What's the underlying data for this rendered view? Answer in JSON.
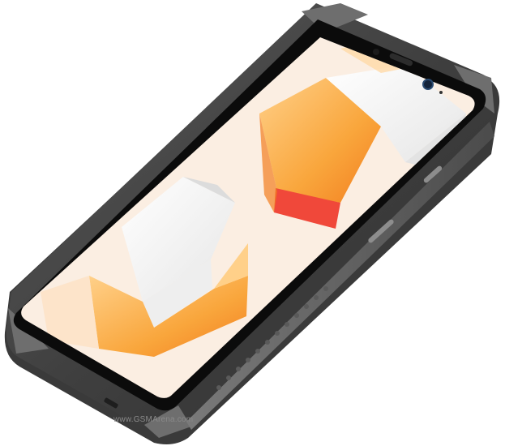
{
  "photo": {
    "subject": "rugged smartphone",
    "watermark": "www.GSMArena.com"
  },
  "colors": {
    "frame_outer": "#4a4a4a",
    "frame_mid": "#6b6b6b",
    "frame_highlight": "#9a9a9a",
    "bezel": "#0b0b0b",
    "wallpaper_bg": "#fbeee2",
    "orange_light": "#ffd089",
    "orange": "#f9a63c",
    "orange_deep": "#f27d1f",
    "red": "#f0483a",
    "white_block": "#f6f6f6",
    "grey_block": "#dcdcdc"
  }
}
